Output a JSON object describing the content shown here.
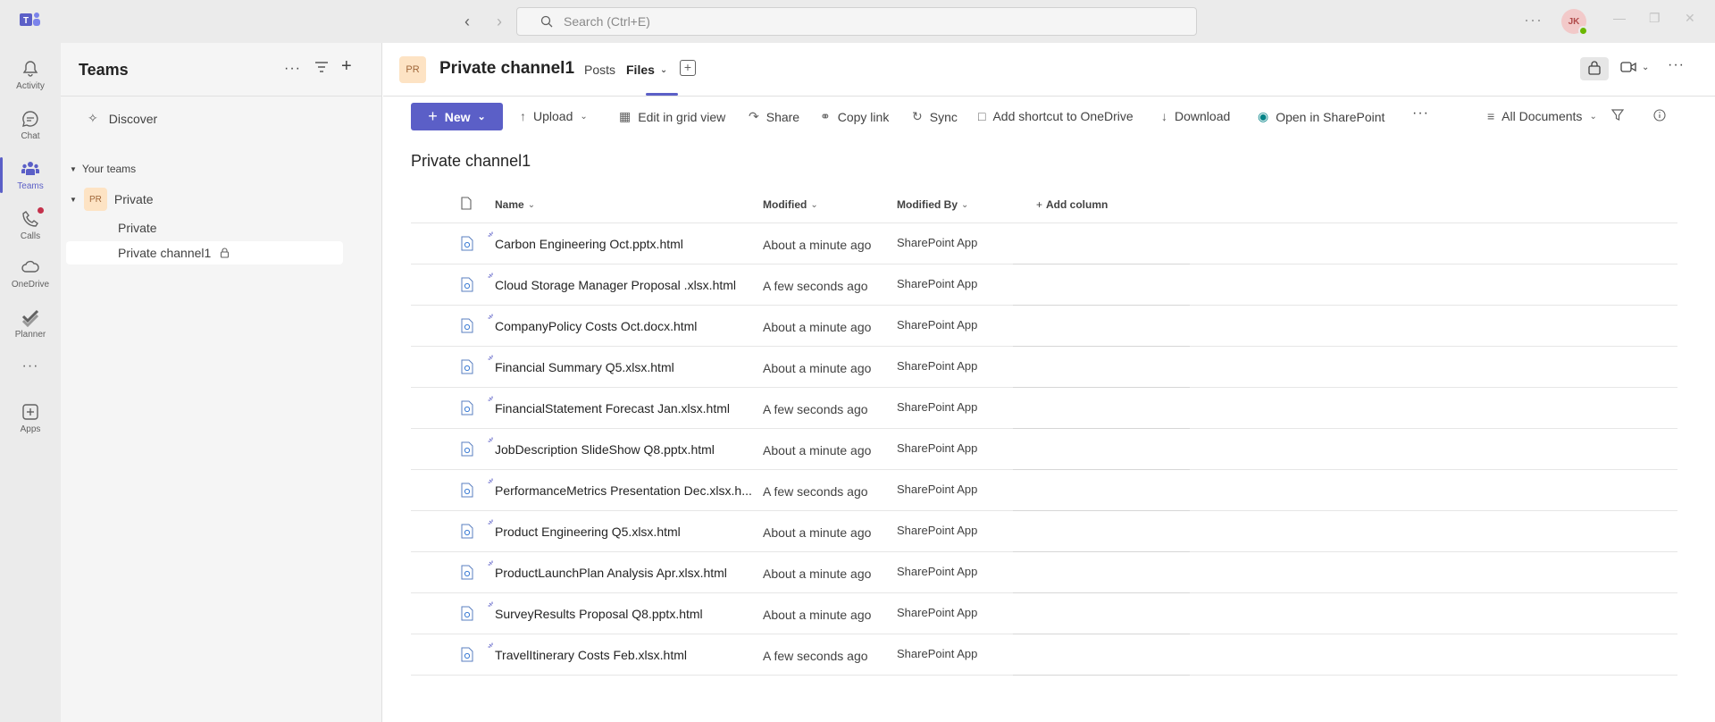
{
  "titlebar": {
    "search_placeholder": "Search (Ctrl+E)",
    "avatar_initials": "JK",
    "more_label": "···"
  },
  "rail": {
    "items": [
      {
        "label": "Activity",
        "icon": "bell-icon"
      },
      {
        "label": "Chat",
        "icon": "chat-icon"
      },
      {
        "label": "Teams",
        "icon": "teams-icon"
      },
      {
        "label": "Calls",
        "icon": "phone-icon"
      },
      {
        "label": "OneDrive",
        "icon": "cloud-icon"
      },
      {
        "label": "Planner",
        "icon": "planner-icon"
      },
      {
        "label": "···",
        "icon": "more-icon"
      },
      {
        "label": "Apps",
        "icon": "apps-icon"
      }
    ]
  },
  "panel": {
    "title": "Teams",
    "discover": "Discover",
    "your_teams": "Your teams",
    "team": {
      "avatar": "PR",
      "name": "Private"
    },
    "channels": [
      "Private",
      "Private channel1"
    ]
  },
  "channel": {
    "avatar": "PR",
    "title": "Private channel1",
    "tabs": {
      "posts": "Posts",
      "files": "Files"
    }
  },
  "commands": {
    "new": "New",
    "upload": "Upload",
    "edit_grid": "Edit in grid view",
    "share": "Share",
    "copy_link": "Copy link",
    "sync": "Sync",
    "add_shortcut": "Add shortcut to OneDrive",
    "download": "Download",
    "open_sp": "Open in SharePoint",
    "more": "···",
    "view": "All Documents"
  },
  "list": {
    "title": "Private channel1",
    "columns": {
      "name": "Name",
      "modified": "Modified",
      "modified_by": "Modified By",
      "add_column": "Add column"
    },
    "rows": [
      {
        "name": "Carbon Engineering Oct.pptx.html",
        "modified": "About a minute ago",
        "modified_by": "SharePoint App"
      },
      {
        "name": "Cloud Storage Manager Proposal .xlsx.html",
        "modified": "A few seconds ago",
        "modified_by": "SharePoint App"
      },
      {
        "name": "CompanyPolicy Costs Oct.docx.html",
        "modified": "About a minute ago",
        "modified_by": "SharePoint App"
      },
      {
        "name": "Financial Summary Q5.xlsx.html",
        "modified": "About a minute ago",
        "modified_by": "SharePoint App"
      },
      {
        "name": "FinancialStatement Forecast Jan.xlsx.html",
        "modified": "A few seconds ago",
        "modified_by": "SharePoint App"
      },
      {
        "name": "JobDescription SlideShow Q8.pptx.html",
        "modified": "About a minute ago",
        "modified_by": "SharePoint App"
      },
      {
        "name": "PerformanceMetrics Presentation Dec.xlsx.h...",
        "modified": "A few seconds ago",
        "modified_by": "SharePoint App"
      },
      {
        "name": "Product Engineering Q5.xlsx.html",
        "modified": "About a minute ago",
        "modified_by": "SharePoint App"
      },
      {
        "name": "ProductLaunchPlan Analysis Apr.xlsx.html",
        "modified": "About a minute ago",
        "modified_by": "SharePoint App"
      },
      {
        "name": "SurveyResults Proposal Q8.pptx.html",
        "modified": "About a minute ago",
        "modified_by": "SharePoint App"
      },
      {
        "name": "TravelItinerary Costs Feb.xlsx.html",
        "modified": "A few seconds ago",
        "modified_by": "SharePoint App"
      }
    ]
  },
  "colors": {
    "accent": "#5b5fc7",
    "rail_bg": "#ebebeb",
    "panel_bg": "#f5f5f5",
    "notification": "#c4314b"
  }
}
